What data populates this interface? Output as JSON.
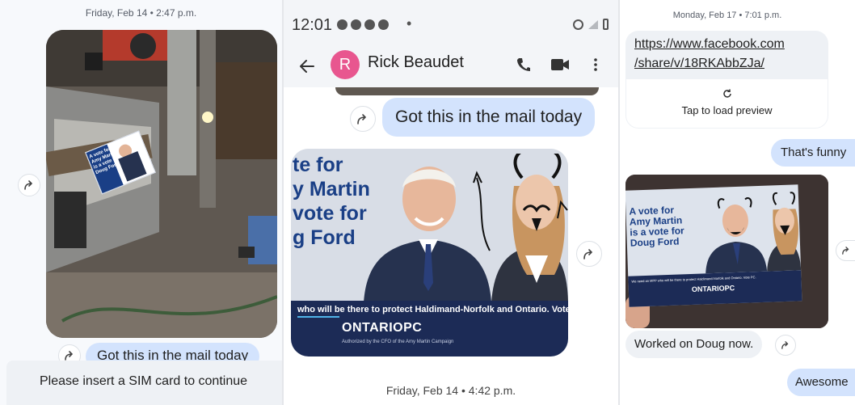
{
  "left_panel": {
    "timestamp": "Friday, Feb 14 • 2:47 p.m.",
    "photo_poster_lines": [
      "A vote for",
      "Amy Martin",
      "is a vote for",
      "Doug Ford"
    ],
    "partial_bubble": "Got this in the mail today",
    "sim_banner": "Please insert a SIM card to continue"
  },
  "middle_panel": {
    "status_bar": {
      "time": "12:01",
      "dot": "•"
    },
    "header": {
      "avatar_letter": "R",
      "contact_name": "Rick Beaudet"
    },
    "message_out": "Got this in the mail today",
    "poster": {
      "headline_lines": [
        "te for",
        "y Martin",
        "vote for",
        "g Ford"
      ],
      "tagline": "who will be there to protect Haldimand-Norfolk and Ontario. Vote PC.",
      "logo_text": "ONTARIOPC",
      "authorized": "Authorized by the CFO of the Amy Martin Campaign"
    },
    "footer_timestamp": "Friday, Feb 14 • 4:42 p.m."
  },
  "right_panel": {
    "timestamp": "Monday, Feb 17 • 7:01 p.m.",
    "link_lines": [
      "https://www.facebook.com",
      "/share/v/18RKAbbZJa/"
    ],
    "preview_label": "Tap to load preview",
    "reply_funny": "That's funny",
    "photo_poster_lines": [
      "A vote for",
      "Amy Martin",
      "is a vote for",
      "Doug Ford"
    ],
    "photo_logo": "ONTARIOPC",
    "photo_small_text": "We need an MPP who will be there to protect Haldimand-Norfolk and Ontario. Vote PC.",
    "message_in": "Worked on Doug now.",
    "reply_awesome": "Awesome"
  },
  "colors": {
    "outgoing_bubble": "#d3e3fd",
    "incoming_bubble": "#eef1f5",
    "avatar": "#e8568f",
    "poster_blue": "#1a3f86",
    "poster_navy": "#1c2b56"
  }
}
